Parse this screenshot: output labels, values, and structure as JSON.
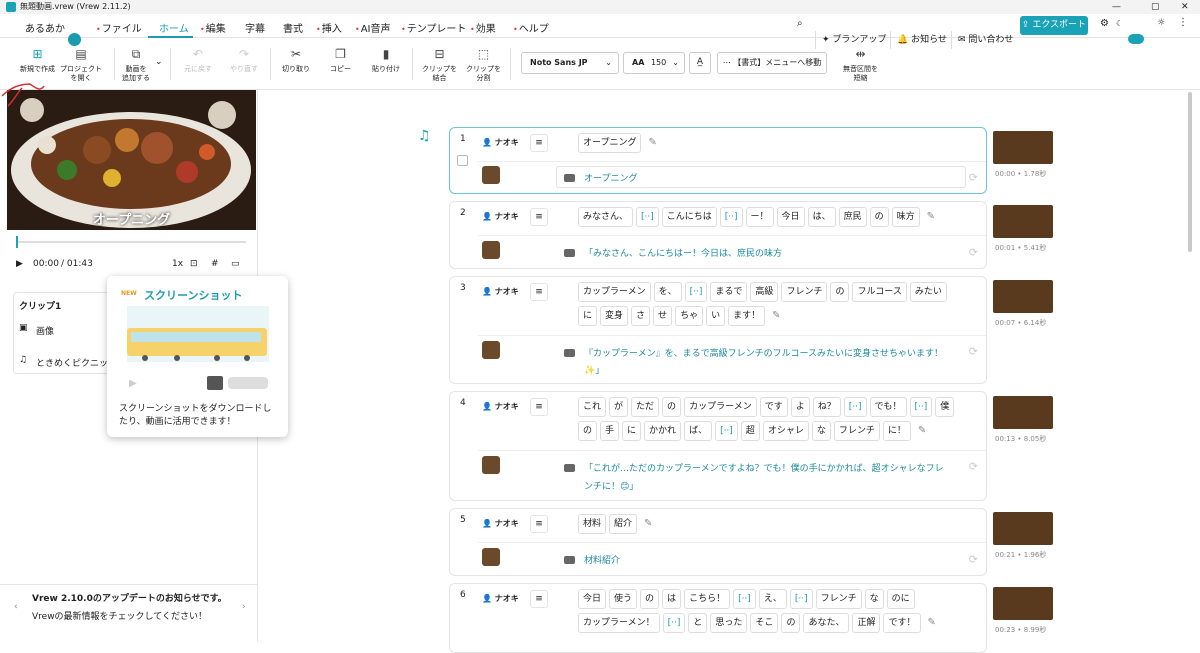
{
  "window": {
    "title": "無題動画.vrew (Vrew 2.11.2)",
    "min": "—",
    "max": "▢",
    "close": "✕"
  },
  "menu": {
    "user": "あるあか",
    "items": [
      {
        "label": "ファイル",
        "dot": true
      },
      {
        "label": "ホーム",
        "dot": false,
        "active": true
      },
      {
        "label": "編集",
        "dot": true
      },
      {
        "label": "字幕",
        "dot": false
      },
      {
        "label": "書式",
        "dot": false
      },
      {
        "label": "挿入",
        "dot": true
      },
      {
        "label": "AI音声",
        "dot": true
      },
      {
        "label": "テンプレート",
        "dot": true
      },
      {
        "label": "効果",
        "dot": true
      },
      {
        "label": "ヘルプ",
        "dot": true
      }
    ],
    "plan": "プランアップ",
    "notice": "お知らせ",
    "contact": "問い合わせ",
    "export": "エクスポート"
  },
  "toolbar": {
    "new": "新規で作成",
    "open": "プロジェクト\nを開く",
    "add_video": "動画を\n追加する",
    "undo": "元に戻す",
    "redo": "やり直す",
    "cut": "切り取り",
    "copy": "コピー",
    "paste": "貼り付け",
    "merge": "クリップを\n結合",
    "split": "クリップを\n分割",
    "font": "Noto Sans JP",
    "size": "150",
    "format_menu": "【書式】メニューへ移動",
    "silence": "無音区間を\n短縮"
  },
  "player": {
    "caption": "オープニング",
    "time": "00:00",
    "duration": "/ 01:43",
    "speed": "1x"
  },
  "clip_panel": {
    "title": "クリップ1",
    "image": "画像",
    "music": "ときめくピクニック"
  },
  "popup": {
    "badge": "NEW",
    "title": "スクリーンショット",
    "desc": "スクリーンショットをダウンロードしたり、動画に活用できます！"
  },
  "news": {
    "title": "Vrew 2.10.0のアップデートのお知らせです。",
    "body": "Vrewの最新情報をチェックしてください！"
  },
  "clips": [
    {
      "num": "1",
      "speaker": "ナオキ",
      "words": [
        "オープニング"
      ],
      "subtitle": "オープニング",
      "time": "00:00 • 1.78秒"
    },
    {
      "num": "2",
      "speaker": "ナオキ",
      "words": [
        "みなさん、",
        "[··]",
        "こんにちは",
        "[··]",
        "ー！",
        "今日",
        "は、",
        "庶民",
        "の",
        "味方"
      ],
      "subtitle": "「みなさん、こんにちはー！今日は、庶民の味方",
      "time": "00:01 • 5.41秒"
    },
    {
      "num": "3",
      "speaker": "ナオキ",
      "words": [
        "カップラーメン",
        "を、",
        "[··]",
        "まるで",
        "高級",
        "フレンチ",
        "の",
        "フルコース",
        "みたい",
        "に",
        "変身",
        "さ",
        "せ",
        "ちゃ",
        "い",
        "ます！"
      ],
      "subtitle": "『カップラーメン』を、まるで高級フレンチのフルコースみたいに変身させちゃいます！",
      "subtitle2": "✨」",
      "time": "00:07 • 6.14秒"
    },
    {
      "num": "4",
      "speaker": "ナオキ",
      "words": [
        "これ",
        "が",
        "ただ",
        "の",
        "カップラーメン",
        "です",
        "よ",
        "ね？",
        "[··]",
        "でも！",
        "[··]",
        "僕",
        "の",
        "手",
        "に",
        "かかれ",
        "ば、",
        "[··]",
        "超",
        "オシャレ",
        "な",
        "フレンチ",
        "に！"
      ],
      "subtitle": "「これが…ただのカップラーメンですよね？でも！僕の手にかかれば、超オシャレなフレ",
      "subtitle2": "ンチに！😊」",
      "time": "00:13 • 8.05秒"
    },
    {
      "num": "5",
      "speaker": "ナオキ",
      "words": [
        "材料",
        "紹介"
      ],
      "subtitle": "材料紹介",
      "time": "00:21 • 1.96秒"
    },
    {
      "num": "6",
      "speaker": "ナオキ",
      "words": [
        "今日",
        "使う",
        "の",
        "は",
        "こちら！",
        "[··]",
        "え、",
        "[··]",
        "フレンチ",
        "な",
        "のに",
        "カップラーメン！",
        "[··]",
        "と",
        "思った",
        "そこ",
        "の",
        "あなた、",
        "正解",
        "です！"
      ],
      "subtitle": "",
      "time": "00:23 • 8.99秒"
    }
  ]
}
